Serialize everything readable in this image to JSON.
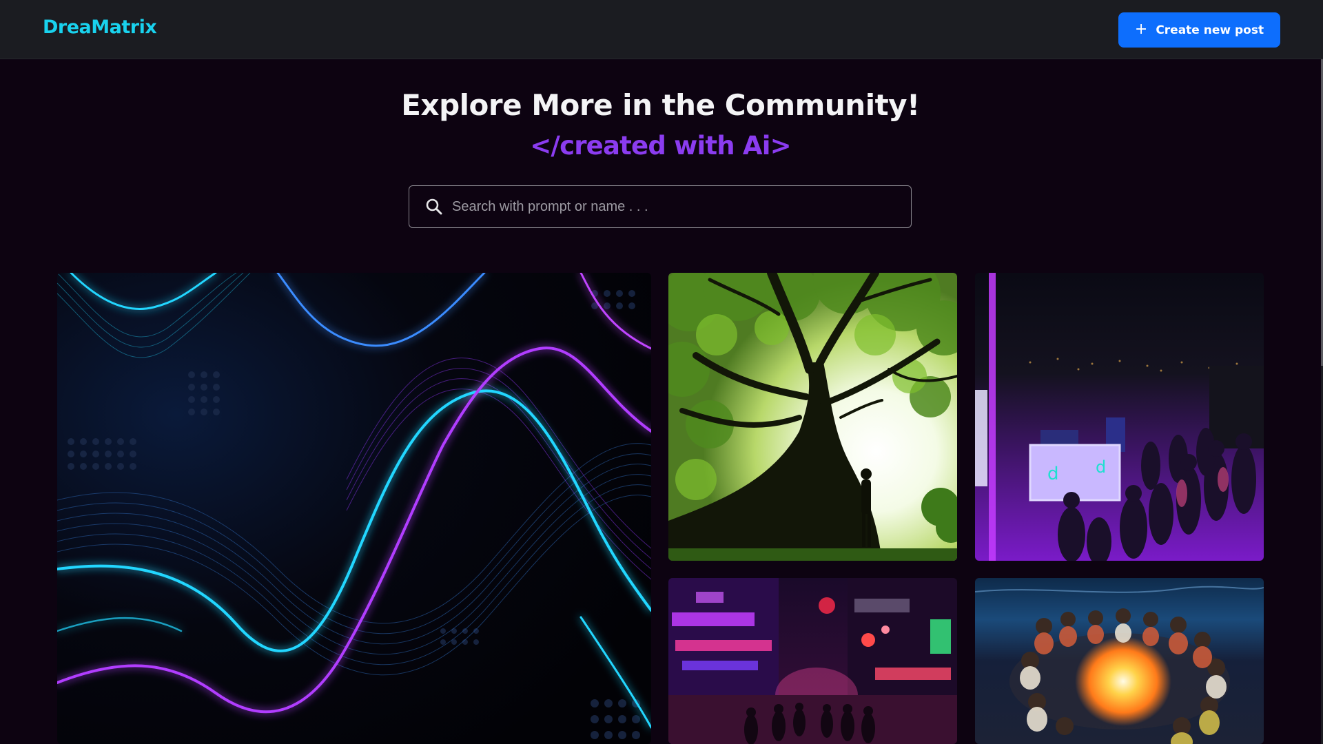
{
  "app": {
    "name": "DreaMatrix"
  },
  "header": {
    "create_label": "Create new post",
    "create_icon": "plus-icon"
  },
  "hero": {
    "title": "Explore More in the Community!",
    "subtitle": "</created with Ai>"
  },
  "search": {
    "placeholder": "Search with prompt or name . . .",
    "value": "",
    "icon": "search-icon"
  },
  "gallery": {
    "items": [
      {
        "scene": "neon waves"
      },
      {
        "scene": "tree silhouette"
      },
      {
        "scene": "rooftop party"
      },
      {
        "scene": "neon street"
      },
      {
        "scene": "beach bonfire"
      }
    ]
  },
  "colors": {
    "brand": "#19d2ee",
    "accent": "#8b3cf0",
    "primary_button": "#0d6efd",
    "navbar": "#1b1c21",
    "background": "#0d0311"
  }
}
